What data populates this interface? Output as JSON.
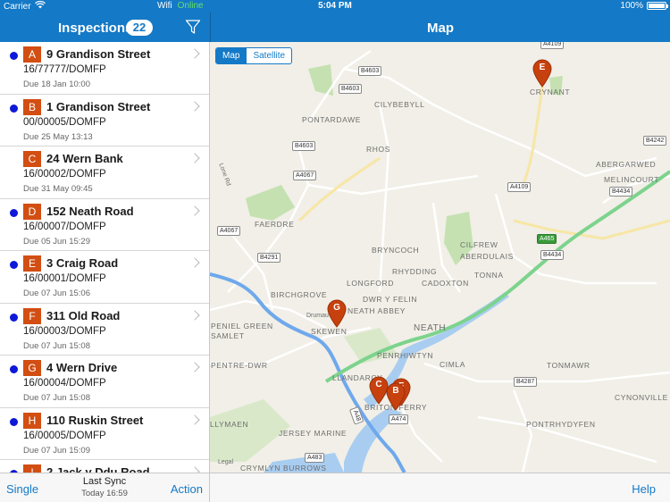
{
  "statusbar": {
    "carrier": "Carrier",
    "wifi": "Wifi",
    "online": "Online",
    "time": "5:04 PM",
    "battery": "100%"
  },
  "left_nav": {
    "title": "Inspections",
    "count": "22",
    "filter_icon": "filter-icon"
  },
  "right_nav": {
    "title": "Map"
  },
  "inspections": [
    {
      "letter": "A",
      "address": "9 Grandison Street",
      "ref": "16/77777/DOMFP",
      "due": "Due 18 Jan 10:00",
      "dot": true
    },
    {
      "letter": "B",
      "address": "1 Grandison Street",
      "ref": "00/00005/DOMFP",
      "due": "Due 25 May 13:13",
      "dot": true
    },
    {
      "letter": "C",
      "address": "24 Wern Bank",
      "ref": "16/00002/DOMFP",
      "due": "Due 31 May 09:45",
      "dot": false
    },
    {
      "letter": "D",
      "address": "152 Neath Road",
      "ref": "16/00007/DOMFP",
      "due": "Due 05 Jun 15:29",
      "dot": true
    },
    {
      "letter": "E",
      "address": "3 Craig Road",
      "ref": "16/00001/DOMFP",
      "due": "Due 07 Jun 15:06",
      "dot": true
    },
    {
      "letter": "F",
      "address": "311 Old Road",
      "ref": "16/00003/DOMFP",
      "due": "Due 07 Jun 15:08",
      "dot": true
    },
    {
      "letter": "G",
      "address": "4 Wern Drive",
      "ref": "16/00004/DOMFP",
      "due": "Due 07 Jun 15:08",
      "dot": true
    },
    {
      "letter": "H",
      "address": "110 Ruskin Street",
      "ref": "16/00005/DOMFP",
      "due": "Due 07 Jun 15:09",
      "dot": true
    },
    {
      "letter": "I",
      "address": "2 Jack y Ddu Road",
      "ref": "",
      "due": "",
      "dot": true
    }
  ],
  "bottom": {
    "single": "Single",
    "last_sync": "Last Sync",
    "sync_time": "Today 16:59",
    "action": "Action",
    "help": "Help"
  },
  "map": {
    "toggle": {
      "map": "Map",
      "satellite": "Satellite",
      "selected": "Map"
    },
    "places": [
      "PONTARDAWE",
      "CILYBEBYLL",
      "RHOS",
      "FAERDRE",
      "BRYNCOCH",
      "RHYDDING",
      "LONGFORD",
      "DWR Y FELIN",
      "NEATH ABBEY",
      "CADOXTON",
      "TONNA",
      "CILFREW",
      "ABERDULAIS",
      "BIRCHGROVE",
      "PENIEL GREEN",
      "SAMLET",
      "SKEWEN",
      "Drumau",
      "NEATH",
      "PENTRE-DWR",
      "LLANDARCY",
      "BRITON FERRY",
      "PENRHIWTYN",
      "CIMLA",
      "TONMAWR",
      "CYNONVILLE",
      "PONTRHYDYFEN",
      "JERSEY MARINE",
      "LLYMAEN",
      "CRYMLYN BURROWS",
      "ABERGARWED",
      "MELINCOURT",
      "CRYNANT",
      "Lone Rd",
      "Legal"
    ],
    "roads": [
      "A4109",
      "B4603",
      "B4603",
      "B4603",
      "A4067",
      "A4067",
      "A4109",
      "B4242",
      "B4434",
      "B4434",
      "A465",
      "B4291",
      "B4287",
      "A474",
      "A48",
      "A483"
    ],
    "pins": [
      "E",
      "G",
      "C",
      "F",
      "B"
    ],
    "pin_color": "#c7410e",
    "colors": {
      "background": "#f1efe7",
      "park": "#c5e1b2",
      "water": "#a9cdf0",
      "motorway": "#6fa8ec",
      "trunk": "#7dd38d",
      "road": "#ffffff"
    }
  }
}
